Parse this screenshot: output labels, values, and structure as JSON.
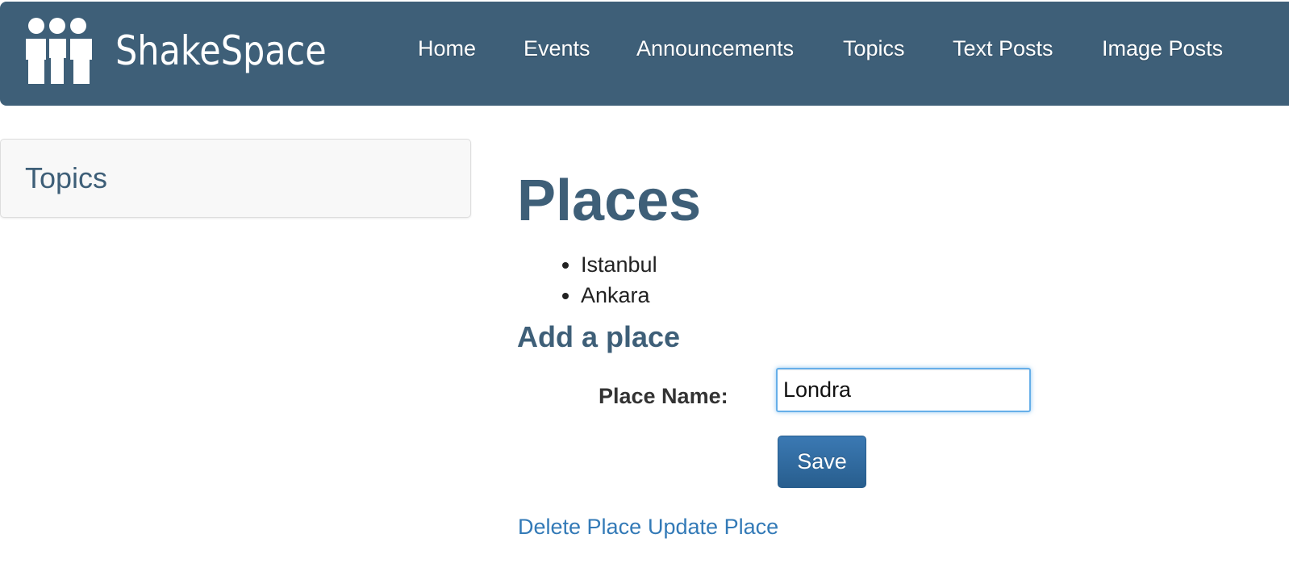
{
  "brand": {
    "name": "ShakeSpace",
    "logo_icon": "people-group-icon"
  },
  "nav": {
    "items": [
      {
        "label": "Home"
      },
      {
        "label": "Events"
      },
      {
        "label": "Announcements"
      },
      {
        "label": "Topics"
      },
      {
        "label": "Text Posts"
      },
      {
        "label": "Image Posts"
      }
    ]
  },
  "sidebar": {
    "heading": "Topics"
  },
  "main": {
    "title": "Places",
    "places": [
      "Istanbul",
      "Ankara"
    ],
    "form": {
      "heading": "Add a place",
      "label": "Place Name:",
      "value": "Londra",
      "save_label": "Save"
    },
    "links": {
      "delete": "Delete Place",
      "update": "Update Place"
    }
  },
  "colors": {
    "navbar": "#3e5f78",
    "heading": "#3e5f78",
    "link": "#337ab7",
    "primary_button": "#285e8e",
    "input_focus": "#66afe9"
  }
}
